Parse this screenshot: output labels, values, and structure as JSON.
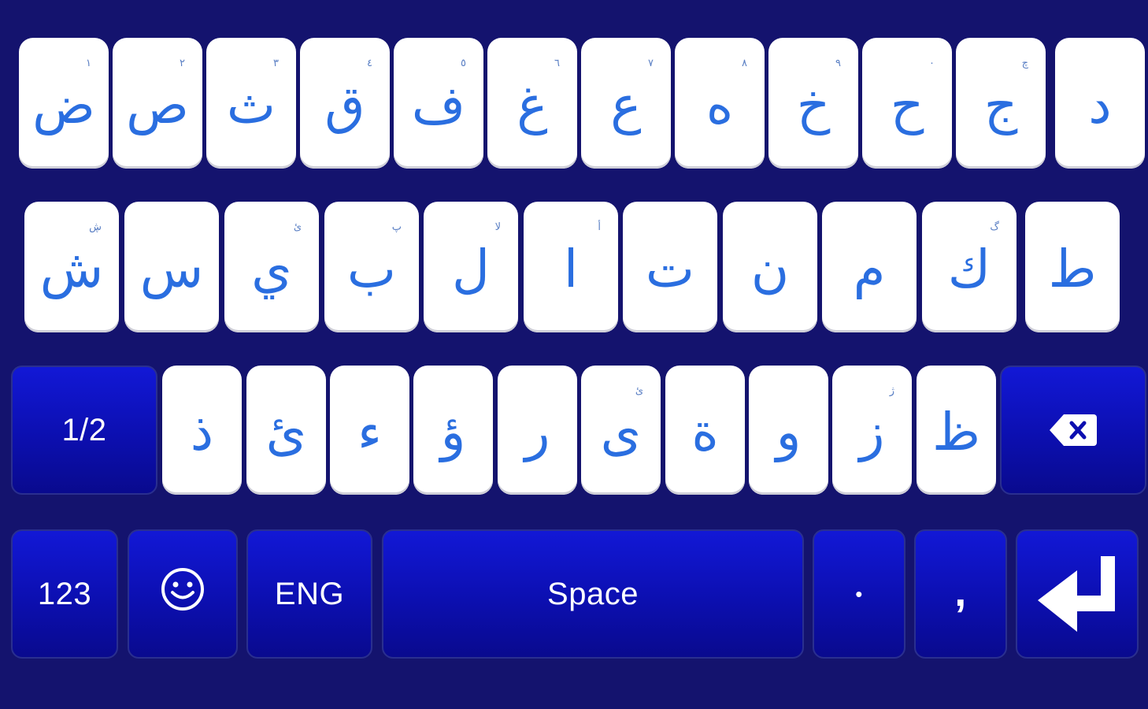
{
  "colors": {
    "background": "#14136e",
    "letter_key_bg": "#ffffff",
    "letter_color": "#2a6ee0",
    "function_key_bg": "#0c0fb0",
    "function_label": "#ffffff"
  },
  "row1": [
    {
      "main": "ض",
      "hint": "١"
    },
    {
      "main": "ص",
      "hint": "٢"
    },
    {
      "main": "ث",
      "hint": "٣"
    },
    {
      "main": "ق",
      "hint": "٤"
    },
    {
      "main": "ف",
      "hint": "٥"
    },
    {
      "main": "غ",
      "hint": "٦"
    },
    {
      "main": "ع",
      "hint": "٧"
    },
    {
      "main": "ه",
      "hint": "٨"
    },
    {
      "main": "خ",
      "hint": "٩"
    },
    {
      "main": "ح",
      "hint": "٠"
    },
    {
      "main": "ج",
      "hint": "چ"
    },
    {
      "main": "د",
      "hint": ""
    }
  ],
  "row2": [
    {
      "main": "ش",
      "hint": "ڜ"
    },
    {
      "main": "س",
      "hint": ""
    },
    {
      "main": "ي",
      "hint": "ئ"
    },
    {
      "main": "ب",
      "hint": "پ"
    },
    {
      "main": "ل",
      "hint": "لا"
    },
    {
      "main": "ا",
      "hint": "أ"
    },
    {
      "main": "ت",
      "hint": ""
    },
    {
      "main": "ن",
      "hint": ""
    },
    {
      "main": "م",
      "hint": ""
    },
    {
      "main": "ك",
      "hint": "گ"
    },
    {
      "main": "ط",
      "hint": ""
    }
  ],
  "row3": [
    {
      "main": "ذ",
      "hint": ""
    },
    {
      "main": "ئ",
      "hint": ""
    },
    {
      "main": "ء",
      "hint": ""
    },
    {
      "main": "ؤ",
      "hint": ""
    },
    {
      "main": "ر",
      "hint": ""
    },
    {
      "main": "ى",
      "hint": "ئ"
    },
    {
      "main": "ة",
      "hint": ""
    },
    {
      "main": "و",
      "hint": ""
    },
    {
      "main": "ز",
      "hint": "ژ"
    },
    {
      "main": "ظ",
      "hint": ""
    }
  ],
  "function_keys": {
    "shift_page": "1/2",
    "numbers": "123",
    "language": "ENG",
    "space": "Space",
    "period": "•",
    "comma": ","
  },
  "icons": {
    "backspace": "backspace-icon",
    "emoji": "smiley-icon",
    "enter": "enter-arrow-icon"
  }
}
